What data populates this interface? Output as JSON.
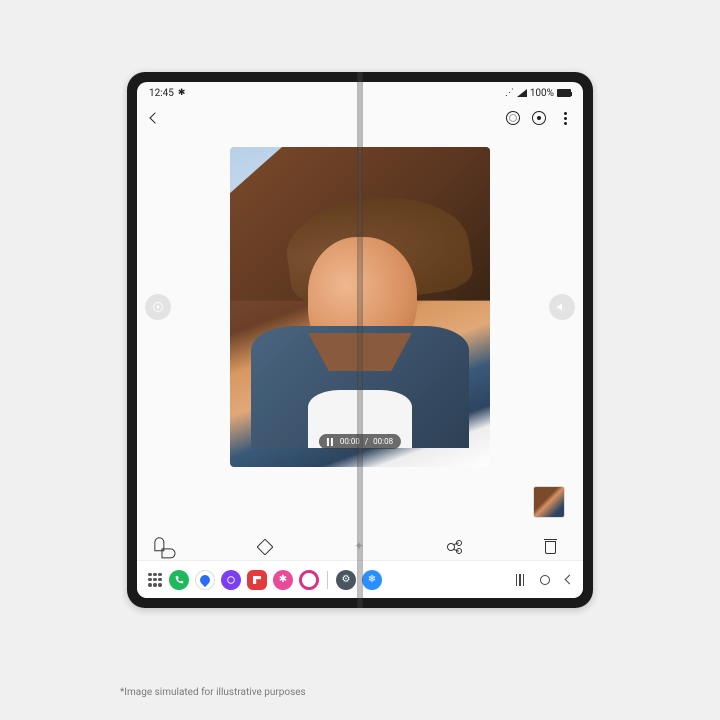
{
  "status": {
    "time": "12:45",
    "battery_text": "100%"
  },
  "player": {
    "current": "00:00",
    "total": "00:08"
  },
  "disclaimer": "*Image simulated for illustrative purposes"
}
